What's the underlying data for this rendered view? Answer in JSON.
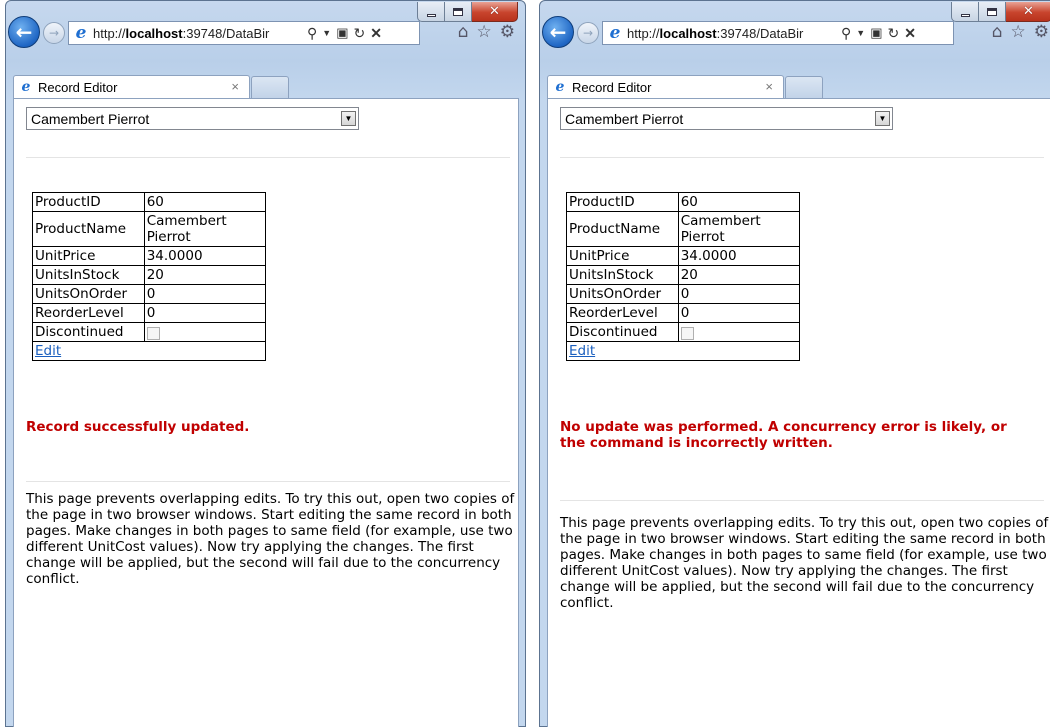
{
  "windows": [
    {
      "address": {
        "prefix": "http://",
        "host": "localhost",
        "rest": ":39748/DataBir"
      },
      "tab": {
        "title": "Record Editor",
        "close": "×"
      },
      "select": {
        "value": "Camembert Pierrot"
      },
      "fields": [
        {
          "label": "ProductID",
          "value": "60"
        },
        {
          "label": "ProductName",
          "value": "Camembert Pierrot"
        },
        {
          "label": "UnitPrice",
          "value": "34.0000"
        },
        {
          "label": "UnitsInStock",
          "value": "20"
        },
        {
          "label": "UnitsOnOrder",
          "value": "0"
        },
        {
          "label": "ReorderLevel",
          "value": "0"
        },
        {
          "label": "Discontinued",
          "value": ""
        }
      ],
      "edit_label": "Edit",
      "status": "Record successfully updated.",
      "description": "This page prevents overlapping edits. To try this out, open two copies of the page in two browser windows. Start editing the same record in both pages. Make changes in both pages to same field (for example, use two different UnitCost values). Now try applying the changes. The first change will be applied, but the second will fail due to the concurrency conflict."
    },
    {
      "address": {
        "prefix": "http://",
        "host": "localhost",
        "rest": ":39748/DataBir"
      },
      "tab": {
        "title": "Record Editor",
        "close": "×"
      },
      "select": {
        "value": "Camembert Pierrot"
      },
      "fields": [
        {
          "label": "ProductID",
          "value": "60"
        },
        {
          "label": "ProductName",
          "value": "Camembert Pierrot"
        },
        {
          "label": "UnitPrice",
          "value": "34.0000"
        },
        {
          "label": "UnitsInStock",
          "value": "20"
        },
        {
          "label": "UnitsOnOrder",
          "value": "0"
        },
        {
          "label": "ReorderLevel",
          "value": "0"
        },
        {
          "label": "Discontinued",
          "value": ""
        }
      ],
      "edit_label": "Edit",
      "status": "No update was performed. A concurrency error is likely, or the command is incorrectly written.",
      "description": "This page prevents overlapping edits. To try this out, open two copies of the page in two browser windows. Start editing the same record in both pages. Make changes in both pages to same field (for example, use two different UnitCost values). Now try applying the changes. The first change will be applied, but the second will fail due to the concurrency conflict."
    }
  ],
  "icons": {
    "back": "back-arrow-icon",
    "forward": "forward-arrow-icon",
    "search": "search-icon",
    "home": "home-icon",
    "favorites": "star-icon",
    "tools": "gear-icon"
  },
  "colors": {
    "status_red": "#c00000",
    "link_blue": "#1a5fbf",
    "chrome_blue": "#c3d7ee"
  }
}
